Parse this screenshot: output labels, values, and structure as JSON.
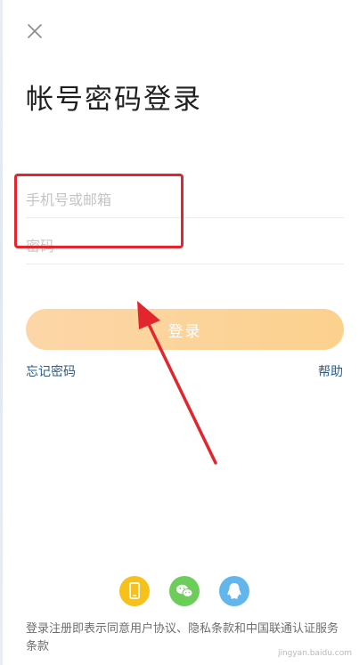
{
  "title": "帐号密码登录",
  "form": {
    "phone_placeholder": "手机号或邮箱",
    "password_placeholder": "密码",
    "login_label": "登录"
  },
  "links": {
    "forgot_password": "忘记密码",
    "help": "帮助"
  },
  "social": {
    "items": [
      {
        "icon": "phone-icon",
        "color": "#f7c01b"
      },
      {
        "icon": "wechat-icon",
        "color": "#6ccd5b"
      },
      {
        "icon": "qq-icon",
        "color": "#62b6ec"
      }
    ]
  },
  "terms": {
    "text": "登录注册即表示同意用户协议、隐私条款和中国联通认证服务条款"
  },
  "watermark": "jingyan.baidu.com",
  "colors": {
    "annotation_red": "#e3262d",
    "login_button": "#fcd398",
    "link_blue": "#2a5d8f"
  }
}
